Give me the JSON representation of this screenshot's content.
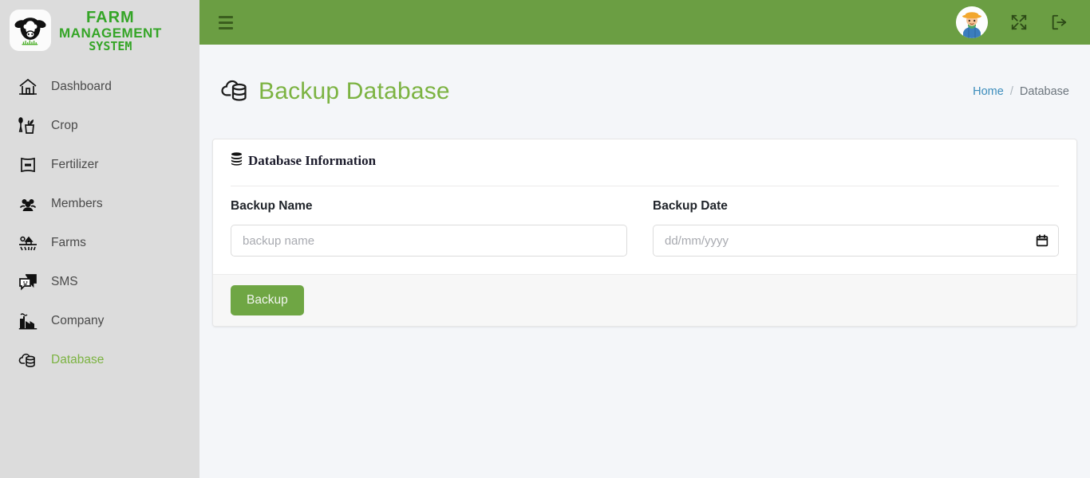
{
  "brand": {
    "logo_icon": "cow-head-logo",
    "line1": "FARM",
    "line2": "MANAGEMENT",
    "line3": "SYSTEM",
    "accent_color": "#35a527"
  },
  "sidebar": {
    "background_color": "#dcdcdc",
    "active_color": "#7cb342",
    "items": [
      {
        "label": "Dashboard",
        "icon": "home-icon",
        "active": false
      },
      {
        "label": "Crop",
        "icon": "plant-pot-icon",
        "active": false
      },
      {
        "label": "Fertilizer",
        "icon": "fertilizer-bag-icon",
        "active": false
      },
      {
        "label": "Members",
        "icon": "people-icon",
        "active": false
      },
      {
        "label": "Farms",
        "icon": "farm-field-icon",
        "active": false
      },
      {
        "label": "SMS",
        "icon": "chat-bubble-icon",
        "active": false
      },
      {
        "label": "Company",
        "icon": "factory-icon",
        "active": false
      },
      {
        "label": "Database",
        "icon": "cloud-database-icon",
        "active": true
      }
    ]
  },
  "topbar": {
    "background_color": "#6b9e43",
    "menu_icon": "hamburger-icon",
    "avatar_icon": "farmer-avatar",
    "fullscreen_icon": "shuffle-expand-icon",
    "logout_icon": "logout-icon"
  },
  "page": {
    "title": "Backup Database",
    "title_icon": "cloud-database-icon",
    "title_color": "#7cb342",
    "breadcrumb": {
      "home": "Home",
      "separator": "/",
      "current": "Database"
    }
  },
  "card": {
    "header_title": "Database Information",
    "header_icon": "database-stack-icon",
    "fields": {
      "backup_name": {
        "label": "Backup Name",
        "placeholder": "backup name",
        "value": ""
      },
      "backup_date": {
        "label": "Backup Date",
        "placeholder": "dd/mm/yyyy",
        "value": "",
        "picker_icon": "calendar-icon"
      }
    },
    "footer": {
      "submit_label": "Backup",
      "submit_color": "#6fa644"
    }
  }
}
